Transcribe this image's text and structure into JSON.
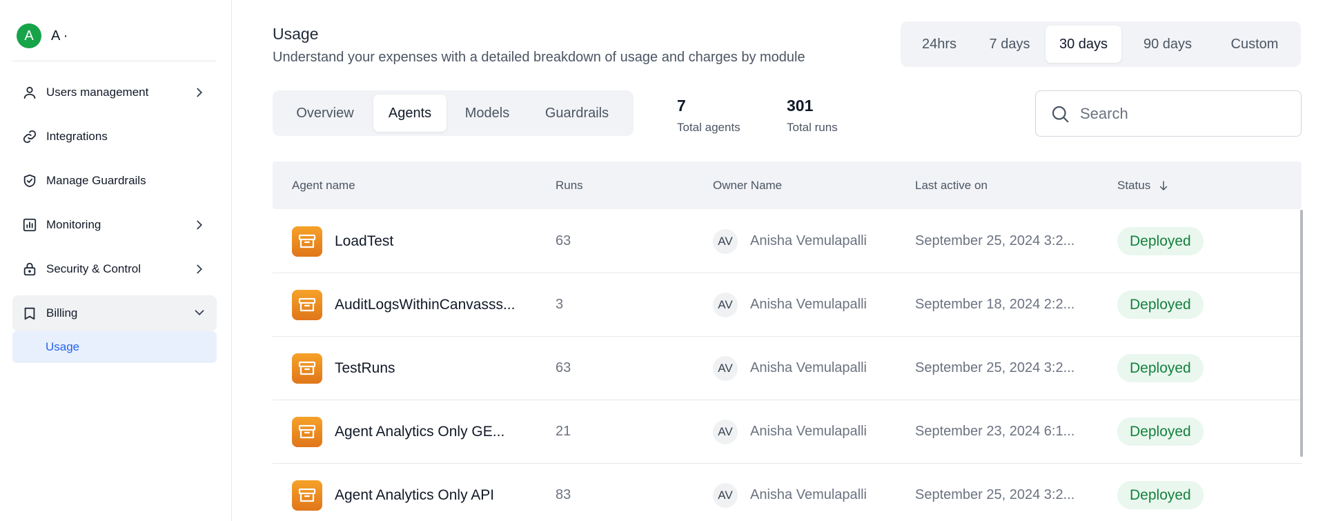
{
  "sidebar": {
    "org_initial": "A",
    "org_name": "A ·",
    "items": [
      {
        "label": "Users management",
        "icon": "user-icon",
        "has_chevron": true
      },
      {
        "label": "Integrations",
        "icon": "link-icon",
        "has_chevron": false
      },
      {
        "label": "Manage Guardrails",
        "icon": "shield-check-icon",
        "has_chevron": false
      },
      {
        "label": "Monitoring",
        "icon": "bar-chart-icon",
        "has_chevron": true
      },
      {
        "label": "Security & Control",
        "icon": "lock-icon",
        "has_chevron": true
      },
      {
        "label": "Billing",
        "icon": "book-icon",
        "has_chevron": true,
        "expanded": true
      }
    ],
    "sub_items": [
      {
        "label": "Usage",
        "selected": true
      }
    ]
  },
  "header": {
    "title": "Usage",
    "subtitle": "Understand your expenses with a detailed breakdown of usage and charges by module"
  },
  "time_range": {
    "options": [
      "24hrs",
      "7 days",
      "30 days",
      "90 days",
      "Custom"
    ],
    "selected": "30 days"
  },
  "tabs": {
    "items": [
      "Overview",
      "Agents",
      "Models",
      "Guardrails"
    ],
    "selected": "Agents"
  },
  "stats": {
    "total_agents_value": "7",
    "total_agents_label": "Total agents",
    "total_runs_value": "301",
    "total_runs_label": "Total runs"
  },
  "search": {
    "placeholder": "Search",
    "value": ""
  },
  "table": {
    "columns": [
      "Agent name",
      "Runs",
      "Owner Name",
      "Last active on",
      "Status"
    ],
    "sort_column": "Status",
    "rows": [
      {
        "name": "LoadTest",
        "runs": "63",
        "owner_initials": "AV",
        "owner": "Anisha Vemulapalli",
        "last_active": "September 25, 2024 3:2...",
        "status": "Deployed"
      },
      {
        "name": "AuditLogsWithinCanvasss...",
        "runs": "3",
        "owner_initials": "AV",
        "owner": "Anisha Vemulapalli",
        "last_active": "September 18, 2024 2:2...",
        "status": "Deployed"
      },
      {
        "name": "TestRuns",
        "runs": "63",
        "owner_initials": "AV",
        "owner": "Anisha Vemulapalli",
        "last_active": "September 25, 2024 3:2...",
        "status": "Deployed"
      },
      {
        "name": "Agent Analytics Only GE...",
        "runs": "21",
        "owner_initials": "AV",
        "owner": "Anisha Vemulapalli",
        "last_active": "September 23, 2024 6:1...",
        "status": "Deployed"
      },
      {
        "name": "Agent Analytics Only API",
        "runs": "83",
        "owner_initials": "AV",
        "owner": "Anisha Vemulapalli",
        "last_active": "September 25, 2024 3:2...",
        "status": "Deployed"
      }
    ]
  },
  "colors": {
    "accent": "#2563eb",
    "status_deployed_text": "#15803d",
    "status_deployed_bg": "#e9f7ee",
    "agent_icon": "#ee8a1f",
    "org_avatar": "#16a34a"
  }
}
